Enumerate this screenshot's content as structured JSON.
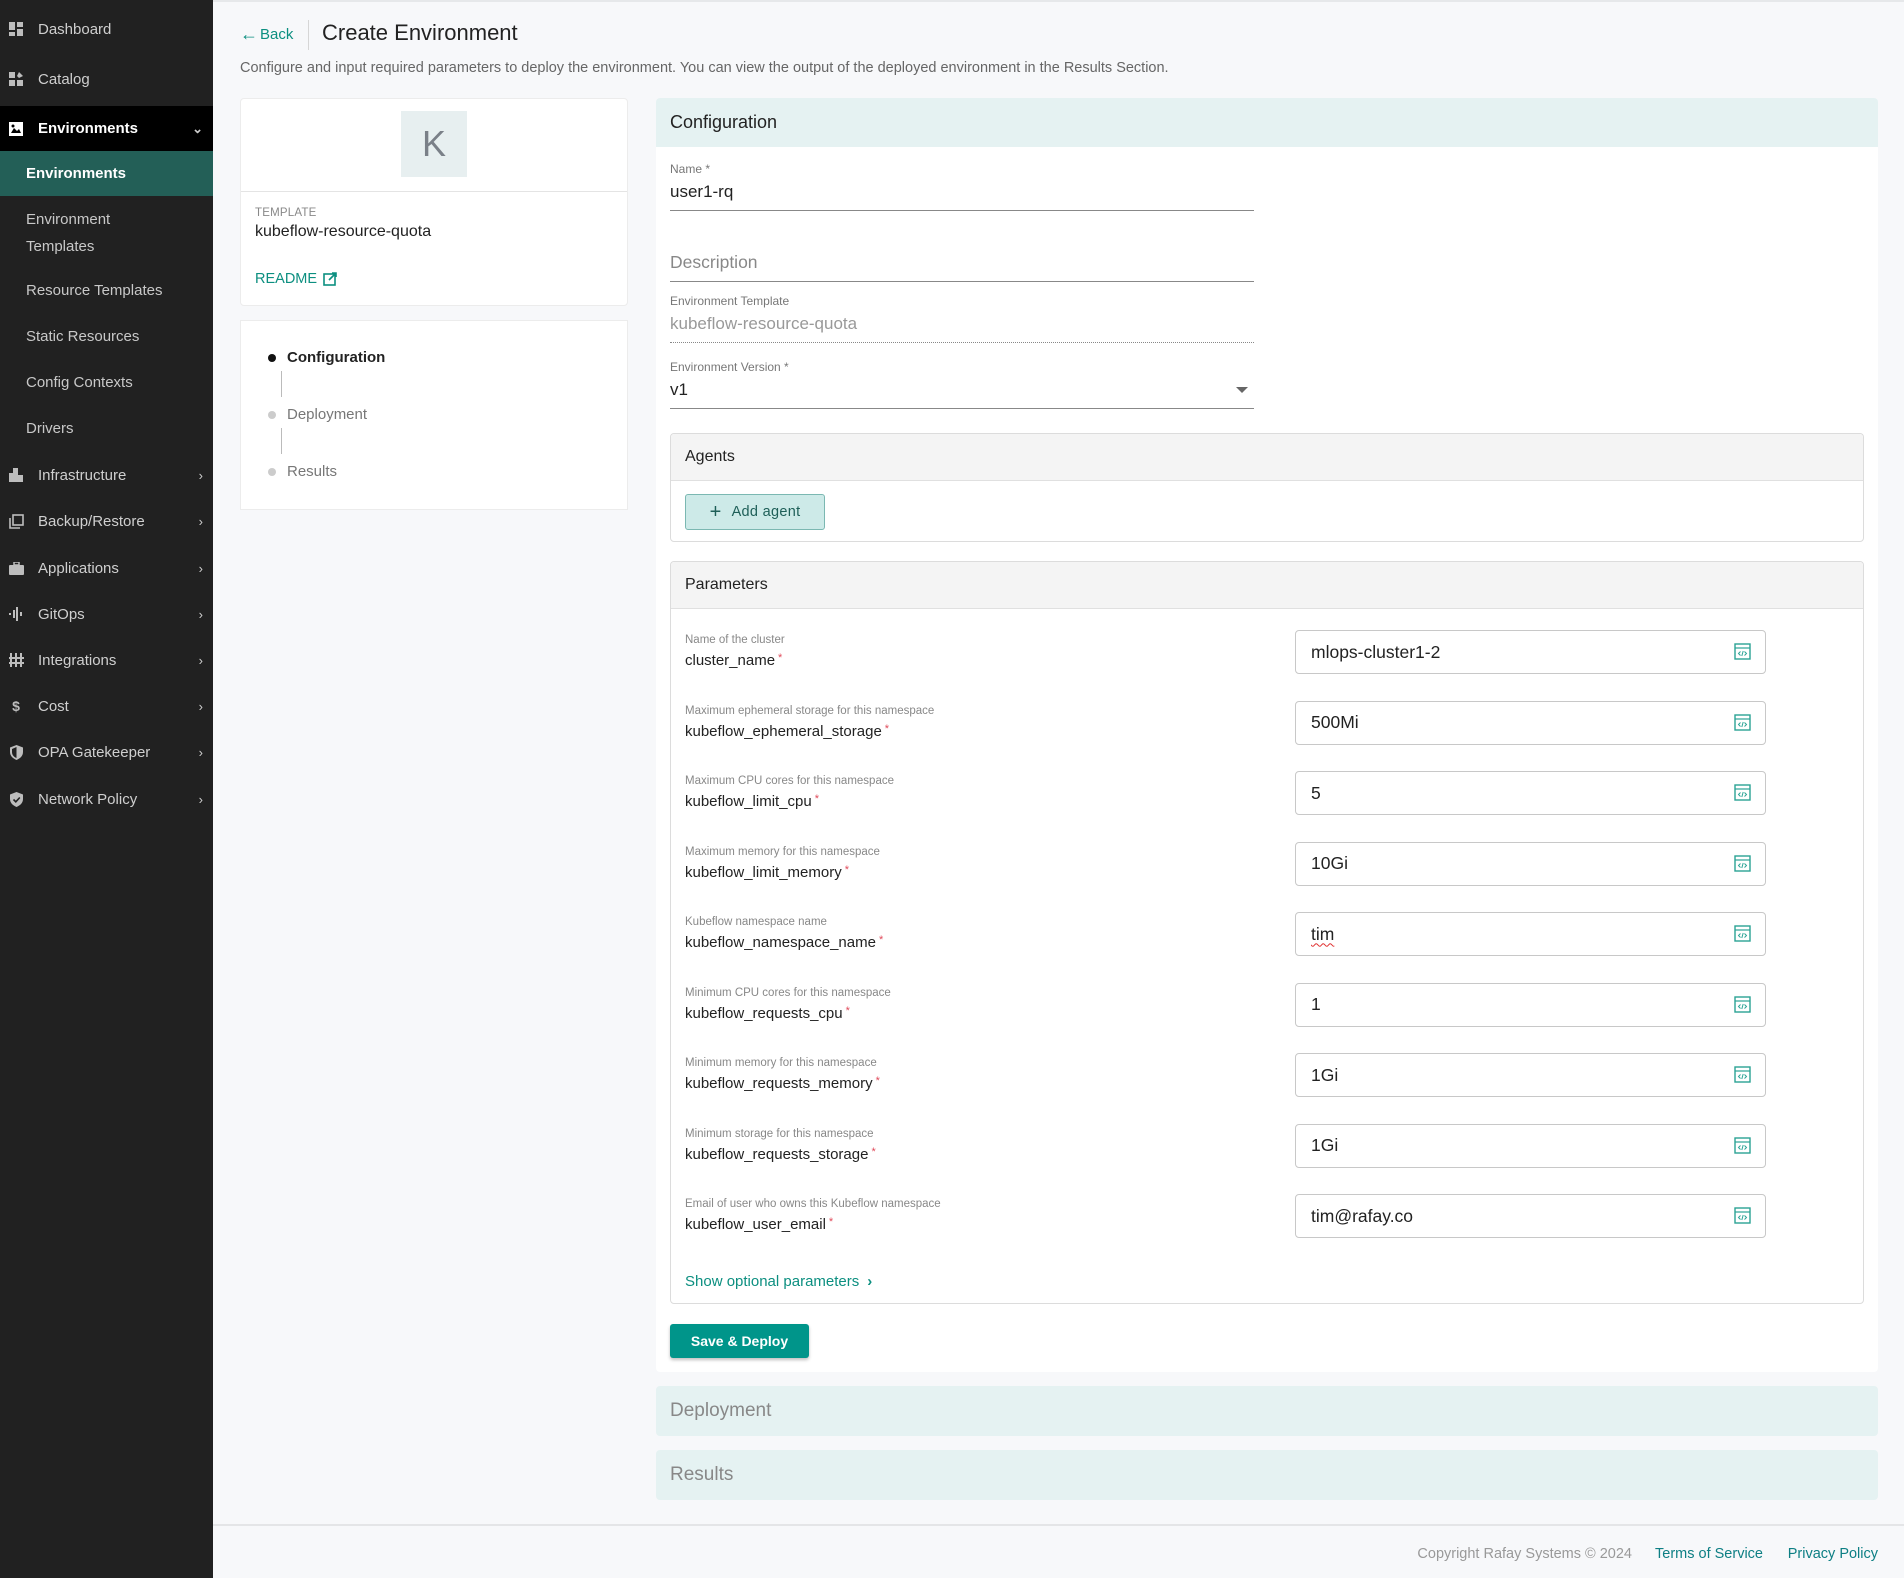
{
  "sidebar": {
    "items": [
      {
        "label": "Dashboard",
        "icon": "dashboard-icon"
      },
      {
        "label": "Catalog",
        "icon": "catalog-icon"
      },
      {
        "label": "Environments",
        "icon": "environments-icon",
        "expanded": true
      },
      {
        "label": "Infrastructure",
        "icon": "infrastructure-icon"
      },
      {
        "label": "Backup/Restore",
        "icon": "backup-icon"
      },
      {
        "label": "Applications",
        "icon": "briefcase-icon"
      },
      {
        "label": "GitOps",
        "icon": "gitops-icon"
      },
      {
        "label": "Integrations",
        "icon": "integrations-icon"
      },
      {
        "label": "Cost",
        "icon": "dollar-icon"
      },
      {
        "label": "OPA Gatekeeper",
        "icon": "shield-icon"
      },
      {
        "label": "Network Policy",
        "icon": "shield-check-icon"
      }
    ],
    "sub_items": [
      {
        "label": "Environments",
        "active": true
      },
      {
        "label": "Environment Templates"
      },
      {
        "label": "Resource Templates"
      },
      {
        "label": "Static Resources"
      },
      {
        "label": "Config Contexts"
      },
      {
        "label": "Drivers"
      }
    ]
  },
  "header": {
    "back_label": "Back",
    "title": "Create Environment",
    "description": "Configure and input required parameters to deploy the environment. You can view the output of the deployed environment in the Results Section."
  },
  "template_card": {
    "avatar_letter": "K",
    "label": "TEMPLATE",
    "name": "kubeflow-resource-quota",
    "readme_label": "README"
  },
  "steps": [
    {
      "label": "Configuration",
      "active": true
    },
    {
      "label": "Deployment"
    },
    {
      "label": "Results"
    }
  ],
  "configuration": {
    "title": "Configuration",
    "name_label": "Name *",
    "name_value": "user1-rq",
    "description_placeholder": "Description",
    "env_template_label": "Environment Template",
    "env_template_value": "kubeflow-resource-quota",
    "env_version_label": "Environment Version *",
    "env_version_value": "v1",
    "agents": {
      "title": "Agents",
      "add_label": "Add agent"
    },
    "parameters": {
      "title": "Parameters",
      "rows": [
        {
          "description": "Name of the cluster",
          "name": "cluster_name",
          "value": "mlops-cluster1-2"
        },
        {
          "description": "Maximum ephemeral storage for this namespace",
          "name": "kubeflow_ephemeral_storage",
          "value": "500Mi"
        },
        {
          "description": "Maximum CPU cores for this namespace",
          "name": "kubeflow_limit_cpu",
          "value": "5"
        },
        {
          "description": "Maximum memory for this namespace",
          "name": "kubeflow_limit_memory",
          "value": "10Gi"
        },
        {
          "description": "Kubeflow namespace name",
          "name": "kubeflow_namespace_name",
          "value": "tim"
        },
        {
          "description": "Minimum CPU cores for this namespace",
          "name": "kubeflow_requests_cpu",
          "value": "1"
        },
        {
          "description": "Minimum memory for this namespace",
          "name": "kubeflow_requests_memory",
          "value": "1Gi"
        },
        {
          "description": "Minimum storage for this namespace",
          "name": "kubeflow_requests_storage",
          "value": "1Gi"
        },
        {
          "description": "Email of user who owns this Kubeflow namespace",
          "name": "kubeflow_user_email",
          "value": "tim@rafay.co"
        }
      ],
      "required_marker": "*",
      "show_optional_label": "Show optional parameters"
    },
    "save_label": "Save & Deploy"
  },
  "deployment_panel": {
    "title": "Deployment"
  },
  "results_panel": {
    "title": "Results"
  },
  "footer": {
    "copyright": "Copyright Rafay Systems © 2024",
    "terms": "Terms of Service",
    "privacy": "Privacy Policy"
  },
  "colors": {
    "accent": "#00958a",
    "sidebar_bg": "#212121",
    "sidebar_active": "#235f57",
    "panel_header": "#e5f2f2",
    "required": "#e04a5a"
  }
}
